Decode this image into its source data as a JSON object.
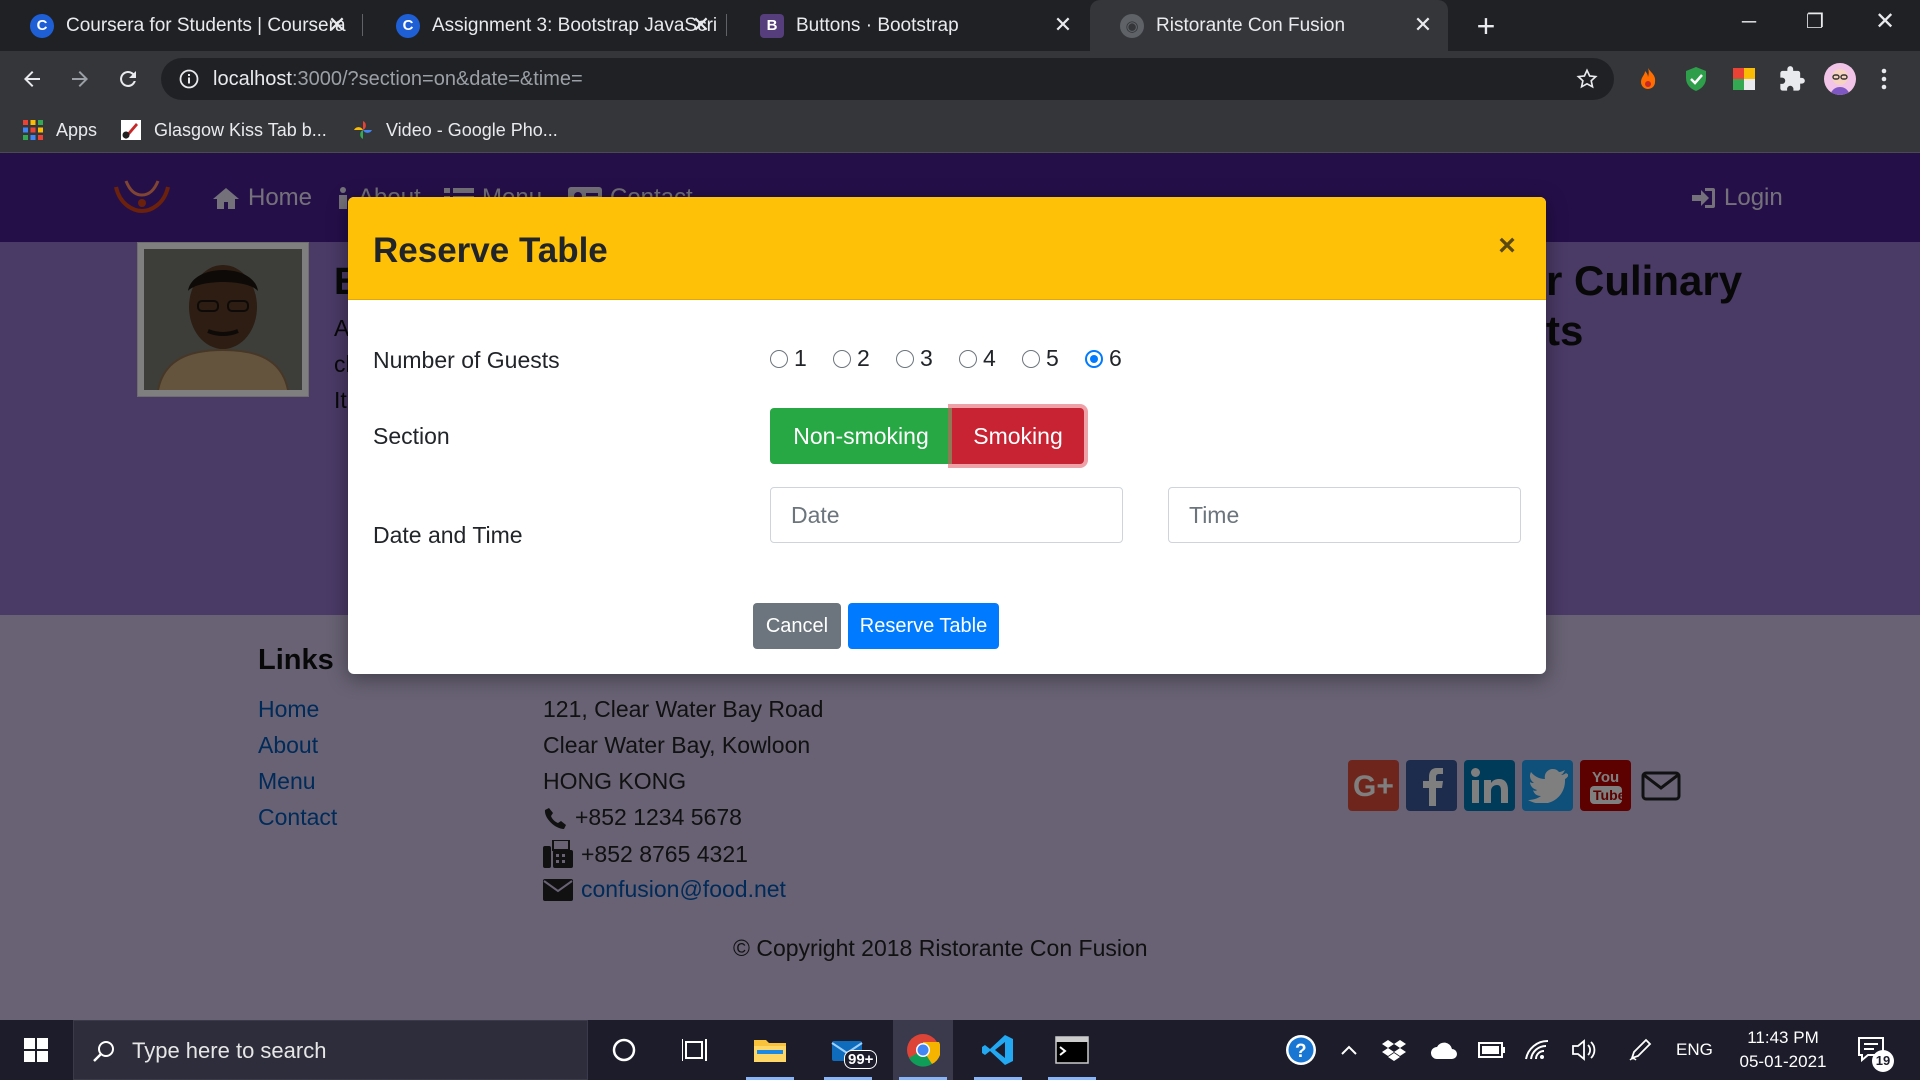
{
  "browser": {
    "tabs": [
      {
        "title": "Coursera for Students | Coursera",
        "active": false
      },
      {
        "title": "Assignment 3: Bootstrap JavaScri",
        "active": false
      },
      {
        "title": "Buttons · Bootstrap",
        "active": false
      },
      {
        "title": "Ristorante Con Fusion",
        "active": true
      }
    ],
    "new_tab_symbol": "+",
    "url_host": "localhost",
    "url_rest": ":3000/?section=on&date=&time=",
    "bookmarks": [
      {
        "label": "Apps"
      },
      {
        "label": "Glasgow Kiss Tab b..."
      },
      {
        "label": "Video - Google Pho..."
      }
    ]
  },
  "site": {
    "nav": {
      "home": "Home",
      "about": "About",
      "menu": "Menu",
      "contact": "Contact",
      "login": "Login"
    },
    "jumbotron": {
      "heading_fragment_left": "E",
      "heading_fragment_right_1": "r Culinary",
      "heading_fragment_right_2": "ts",
      "para_fragments": [
        "A",
        "cl",
        "It"
      ]
    },
    "footer": {
      "links_heading": "Links",
      "links": [
        "Home",
        "About",
        "Menu",
        "Contact"
      ],
      "address": [
        "121, Clear Water Bay Road",
        "Clear Water Bay, Kowloon",
        "HONG KONG"
      ],
      "phone": "+852 1234 5678",
      "fax": "+852 8765 4321",
      "email": "confusion@food.net",
      "copyright": "© Copyright 2018 Ristorante Con Fusion",
      "social": [
        "google-plus",
        "facebook",
        "linkedin",
        "twitter",
        "youtube",
        "mail"
      ]
    }
  },
  "modal": {
    "title": "Reserve Table",
    "close_symbol": "×",
    "guests_label": "Number of Guests",
    "guest_options": [
      "1",
      "2",
      "3",
      "4",
      "5",
      "6"
    ],
    "guests_selected": "6",
    "section_label": "Section",
    "section_nonsmoking": "Non-smoking",
    "section_smoking": "Smoking",
    "section_selected": "Smoking",
    "datetime_label": "Date and Time",
    "date_placeholder": "Date",
    "time_placeholder": "Time",
    "cancel": "Cancel",
    "reserve": "Reserve Table"
  },
  "taskbar": {
    "search_placeholder": "Type here to search",
    "mail_badge": "99+",
    "language": "ENG",
    "time": "11:43 PM",
    "date": "05-01-2021",
    "notifications": "19"
  },
  "colors": {
    "nav_purple": "#4b1f93",
    "modal_header": "#ffc107",
    "success": "#28a745",
    "danger": "#c82333",
    "primary": "#007bff",
    "secondary": "#6c757d"
  }
}
